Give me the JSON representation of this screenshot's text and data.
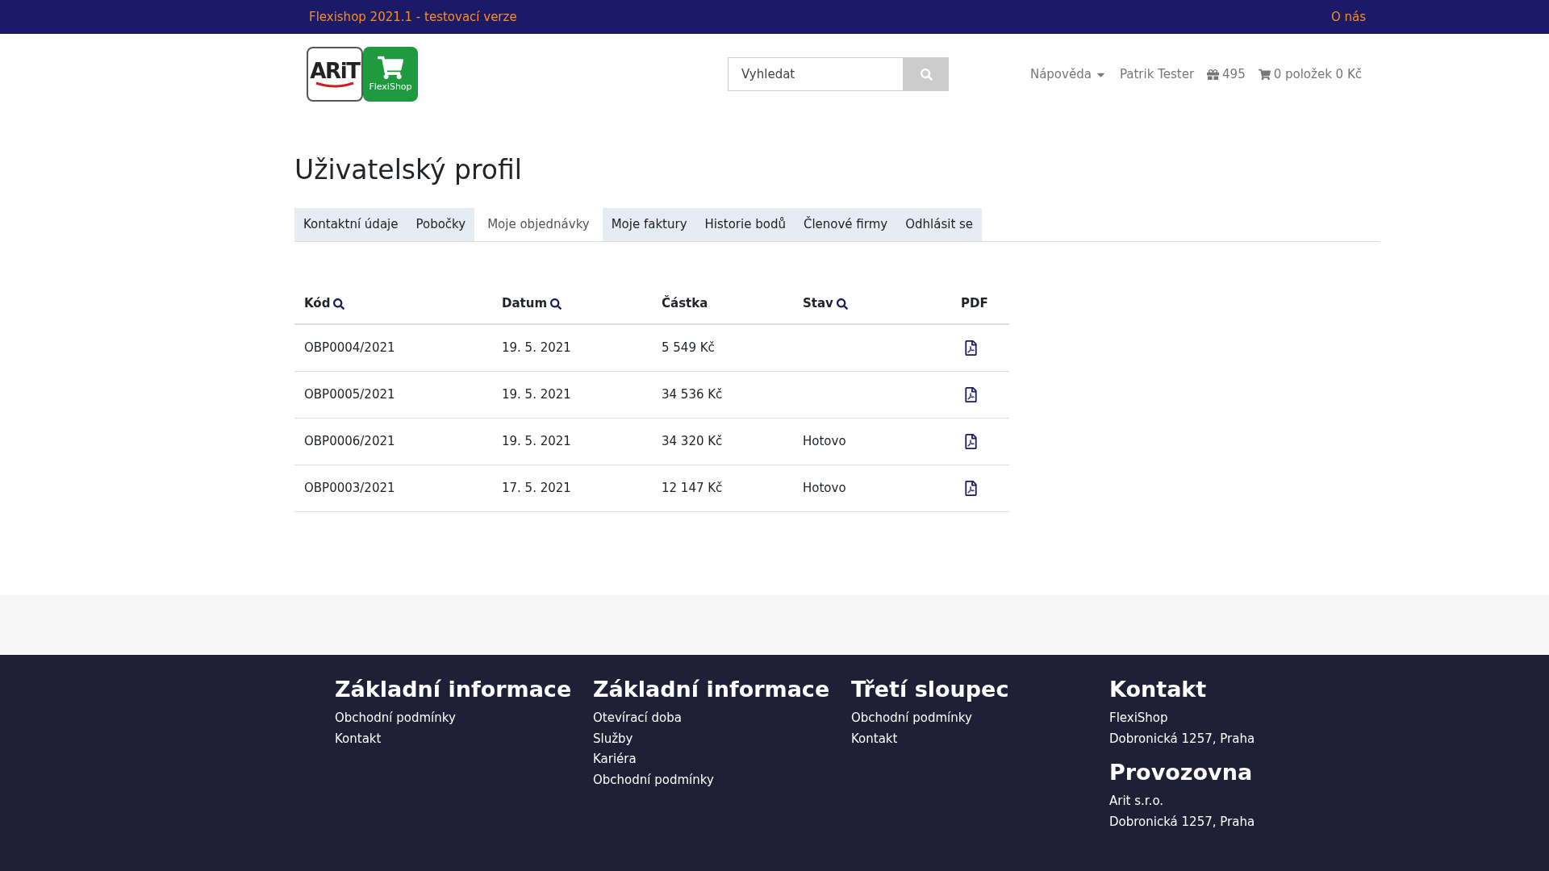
{
  "top_bar": {
    "title": "Flexishop 2021.1 - testovací verze",
    "link": "O nás"
  },
  "header": {
    "logo": {
      "left": "ARiT",
      "right": "FlexiShop"
    },
    "search": {
      "placeholder": "Vyhledat"
    },
    "help": "Nápověda",
    "user": "Patrik Tester",
    "points": "495",
    "cart": "0 položek 0 Kč"
  },
  "page_title": "Uživatelský profil",
  "tabs": [
    {
      "label": "Kontaktní údaje",
      "selected": false
    },
    {
      "label": "Pobočky",
      "selected": false
    },
    {
      "label": "Moje objednávky",
      "selected": true
    },
    {
      "label": "Moje faktury",
      "selected": false
    },
    {
      "label": "Historie bodů",
      "selected": false
    },
    {
      "label": "Členové firmy",
      "selected": false
    },
    {
      "label": "Odhlásit se",
      "selected": false
    }
  ],
  "table": {
    "columns": [
      {
        "label": "Kód",
        "searchable": true
      },
      {
        "label": "Datum",
        "searchable": true
      },
      {
        "label": "Částka",
        "searchable": false
      },
      {
        "label": "Stav",
        "searchable": true
      },
      {
        "label": "PDF",
        "searchable": false
      }
    ],
    "rows": [
      [
        "OBP0004/2021",
        "19. 5. 2021",
        "5 549 Kč",
        ""
      ],
      [
        "OBP0005/2021",
        "19. 5. 2021",
        "34 536 Kč",
        ""
      ],
      [
        "OBP0006/2021",
        "19. 5. 2021",
        "34 320 Kč",
        "Hotovo"
      ],
      [
        "OBP0003/2021",
        "17. 5. 2021",
        "12 147 Kč",
        "Hotovo"
      ]
    ]
  },
  "footer": {
    "columns": [
      {
        "sections": [
          {
            "title": "Základní informace",
            "lines": [
              "Obchodní podmínky",
              "Kontakt"
            ]
          }
        ]
      },
      {
        "sections": [
          {
            "title": "Základní informace",
            "lines": [
              "Otevírací doba",
              "Služby",
              "Kariéra",
              "Obchodní podmínky"
            ]
          }
        ]
      },
      {
        "sections": [
          {
            "title": "Třetí sloupec",
            "lines": [
              "Obchodní podmínky",
              "Kontakt"
            ]
          }
        ]
      },
      {
        "sections": [
          {
            "title": "Kontakt",
            "lines": [
              "FlexiShop",
              "Dobronická 1257, Praha"
            ]
          },
          {
            "title": "Provozovna",
            "lines": [
              "Arit s.r.o.",
              "Dobronická 1257, Praha"
            ]
          }
        ]
      }
    ]
  }
}
